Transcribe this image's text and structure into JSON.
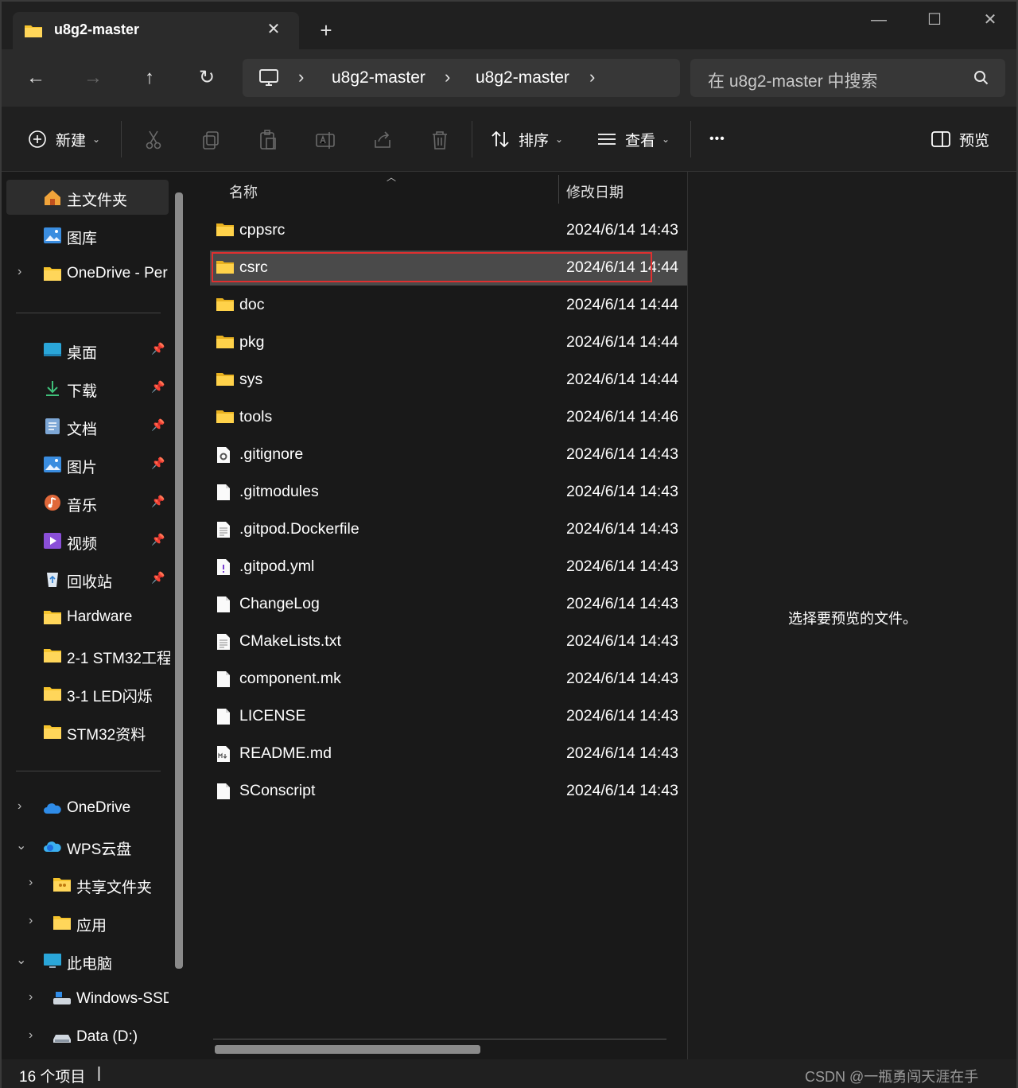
{
  "window": {
    "tab_title": "u8g2-master",
    "new_tab_label": "+",
    "close_tab_glyph": "✕",
    "minimize_glyph": "—",
    "maximize_glyph": "☐",
    "close_glyph": "✕"
  },
  "nav": {
    "back_glyph": "←",
    "forward_glyph": "→",
    "up_glyph": "↑",
    "refresh_glyph": "↻",
    "breadcrumbs": [
      "u8g2-master",
      "u8g2-master"
    ],
    "separator": "›",
    "search_placeholder": "在 u8g2-master 中搜索"
  },
  "toolbar": {
    "new_label": "新建",
    "sort_label": "排序",
    "view_label": "查看",
    "more_label": "•••",
    "preview_label": "预览",
    "icons": [
      "cut-icon",
      "copy-icon",
      "paste-icon",
      "rename-icon",
      "share-icon",
      "delete-icon"
    ]
  },
  "sidebar": {
    "quick": [
      {
        "label": "主文件夹",
        "icon": "home-icon"
      },
      {
        "label": "图库",
        "icon": "gallery-icon"
      },
      {
        "label": "OneDrive - Per",
        "icon": "folder-icon"
      }
    ],
    "pinned": [
      {
        "label": "桌面",
        "icon": "desktop-icon"
      },
      {
        "label": "下载",
        "icon": "download-icon"
      },
      {
        "label": "文档",
        "icon": "document-icon"
      },
      {
        "label": "图片",
        "icon": "pictures-icon"
      },
      {
        "label": "音乐",
        "icon": "music-icon"
      },
      {
        "label": "视频",
        "icon": "video-icon"
      },
      {
        "label": "回收站",
        "icon": "recycle-bin-icon"
      },
      {
        "label": "Hardware",
        "icon": "folder-icon"
      },
      {
        "label": "2-1 STM32工程",
        "icon": "folder-icon"
      },
      {
        "label": "3-1 LED闪烁",
        "icon": "folder-icon"
      },
      {
        "label": "STM32资料",
        "icon": "folder-icon"
      }
    ],
    "tree": [
      {
        "label": "OneDrive",
        "icon": "onedrive-icon"
      },
      {
        "label": "WPS云盘",
        "icon": "wps-cloud-icon"
      },
      {
        "label": "共享文件夹",
        "icon": "shared-folder-icon"
      },
      {
        "label": "应用",
        "icon": "folder-icon"
      },
      {
        "label": "此电脑",
        "icon": "this-pc-icon"
      },
      {
        "label": "Windows-SSD",
        "icon": "drive-c-icon"
      },
      {
        "label": "Data (D:)",
        "icon": "drive-icon"
      }
    ]
  },
  "filelist": {
    "col_name": "名称",
    "col_date": "修改日期",
    "rows": [
      {
        "name": "cppsrc",
        "date": "2024/6/14 14:43",
        "type": "folder"
      },
      {
        "name": "csrc",
        "date": "2024/6/14 14:44",
        "type": "folder"
      },
      {
        "name": "doc",
        "date": "2024/6/14 14:44",
        "type": "folder"
      },
      {
        "name": "pkg",
        "date": "2024/6/14 14:44",
        "type": "folder"
      },
      {
        "name": "sys",
        "date": "2024/6/14 14:44",
        "type": "folder"
      },
      {
        "name": "tools",
        "date": "2024/6/14 14:46",
        "type": "folder"
      },
      {
        "name": ".gitignore",
        "date": "2024/6/14 14:43",
        "type": "config"
      },
      {
        "name": ".gitmodules",
        "date": "2024/6/14 14:43",
        "type": "file"
      },
      {
        "name": ".gitpod.Dockerfile",
        "date": "2024/6/14 14:43",
        "type": "text"
      },
      {
        "name": ".gitpod.yml",
        "date": "2024/6/14 14:43",
        "type": "yml"
      },
      {
        "name": "ChangeLog",
        "date": "2024/6/14 14:43",
        "type": "file"
      },
      {
        "name": "CMakeLists.txt",
        "date": "2024/6/14 14:43",
        "type": "text"
      },
      {
        "name": "component.mk",
        "date": "2024/6/14 14:43",
        "type": "file"
      },
      {
        "name": "LICENSE",
        "date": "2024/6/14 14:43",
        "type": "file"
      },
      {
        "name": "README.md",
        "date": "2024/6/14 14:43",
        "type": "markdown"
      },
      {
        "name": "SConscript",
        "date": "2024/6/14 14:43",
        "type": "file"
      }
    ]
  },
  "preview": {
    "message": "选择要预览的文件。"
  },
  "status": {
    "count": "16 个项目",
    "cursor": "|",
    "watermark": "CSDN @一瓶勇闯天涯在手"
  },
  "colors": {
    "accent_folder": "#f5c32c",
    "selection": "#4a4a4a",
    "highlight_box": "#e03030"
  }
}
